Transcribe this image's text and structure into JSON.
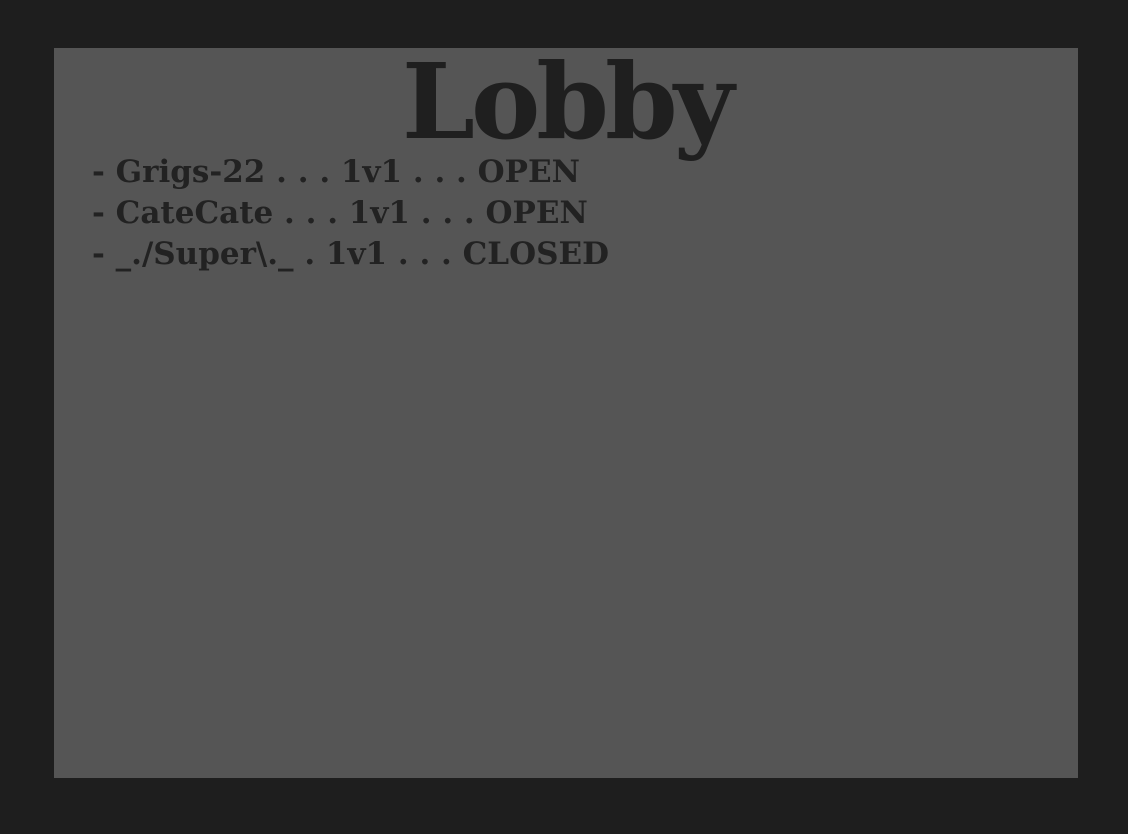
{
  "title": "Lobby",
  "lobbies": [
    {
      "text": "- Grigs-22 . . . 1v1 . . . OPEN"
    },
    {
      "text": "- CateCate . . . 1v1 . . . OPEN"
    },
    {
      "text": "- _./Super\\._ . 1v1 . . . CLOSED"
    }
  ]
}
